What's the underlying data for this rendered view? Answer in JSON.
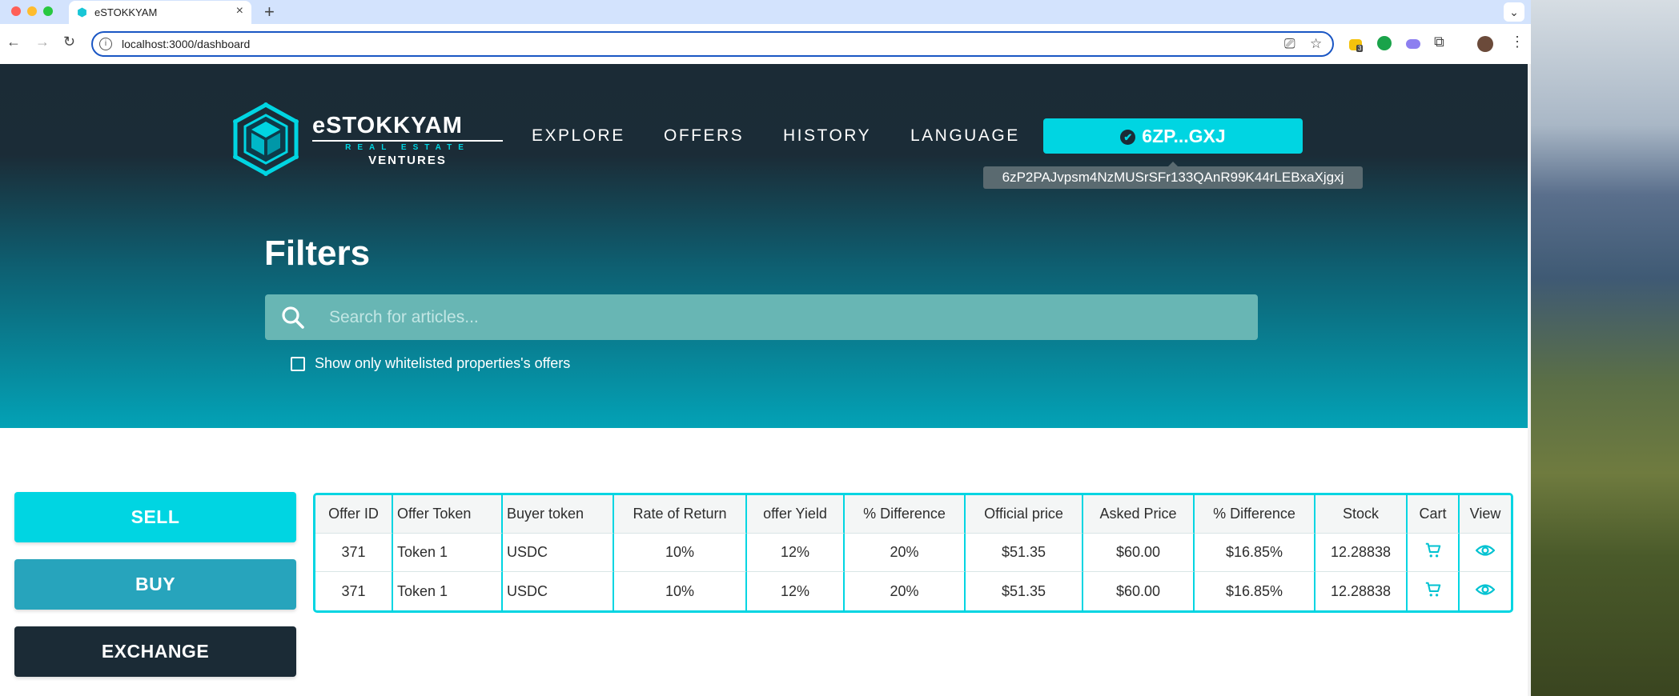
{
  "browser": {
    "tab_title": "eSTOKKYAM",
    "tab_close": "×",
    "new_tab": "+",
    "tab_menu": "⌄",
    "url": "localhost:3000/dashboard",
    "extension_badge": "3"
  },
  "nav": {
    "brand": "eSTOKKYAM",
    "brand_sub": "REAL ESTATE",
    "brand_sub2": "VENTURES",
    "items": [
      "EXPLORE",
      "OFFERS",
      "HISTORY",
      "LANGUAGE"
    ],
    "wallet_short": "6ZP...GXJ",
    "wallet_full": "6zP2PAJvpsm4NzMUSrSFr133QAnR99K44rLEBxaXjgxj"
  },
  "filters": {
    "title": "Filters",
    "search_placeholder": "Search for articles...",
    "whitelist_label": "Show only whitelisted properties's offers"
  },
  "side_buttons": [
    {
      "label": "SELL",
      "color": "#00d5e2"
    },
    {
      "label": "BUY",
      "color": "#27a4bc"
    },
    {
      "label": "EXCHANGE",
      "color": "#1b2b36"
    }
  ],
  "table": {
    "headers": [
      "Offer ID",
      "Offer Token",
      "Buyer token",
      "Rate of Return",
      "offer Yield",
      "% Difference",
      "Official price",
      "Asked Price",
      "% Difference",
      "Stock",
      "Cart",
      "View"
    ],
    "rows": [
      {
        "offer_id": "371",
        "offer_token": "Token 1",
        "buyer_token": "USDC",
        "rate_of_return": "10%",
        "offer_yield": "12%",
        "pct_diff_1": "20%",
        "official_price": "$51.35",
        "asked_price": "$60.00",
        "pct_diff_2": "$16.85%",
        "stock": "12.28838"
      },
      {
        "offer_id": "371",
        "offer_token": "Token 1",
        "buyer_token": "USDC",
        "rate_of_return": "10%",
        "offer_yield": "12%",
        "pct_diff_1": "20%",
        "official_price": "$51.35",
        "asked_price": "$60.00",
        "pct_diff_2": "$16.85%",
        "stock": "12.28838"
      }
    ]
  },
  "colors": {
    "accent": "#00d5e2",
    "dark": "#1b2b36",
    "buy": "#27a4bc"
  }
}
